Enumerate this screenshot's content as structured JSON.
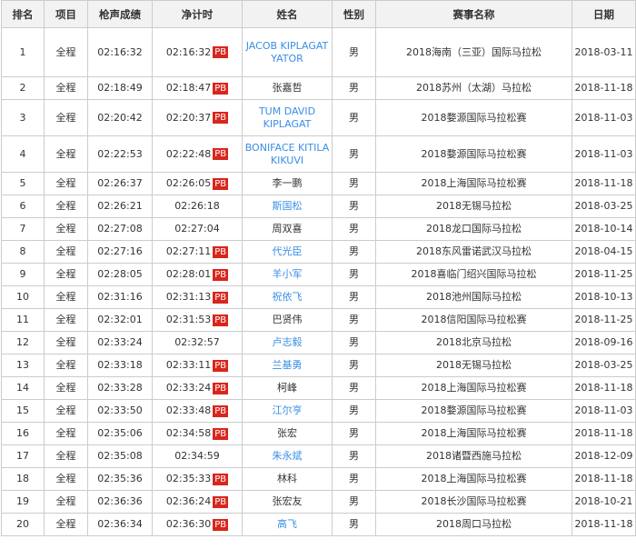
{
  "headers": [
    "排名",
    "项目",
    "枪声成绩",
    "净计时",
    "姓名",
    "性别",
    "赛事名称",
    "日期"
  ],
  "pb_label": "PB",
  "link_color": "#3a8ee6",
  "pb_color": "#d9261c",
  "rows": [
    {
      "rank": "1",
      "item": "全程",
      "gun": "02:16:32",
      "net": "02:16:32",
      "pb": true,
      "name": "JACOB KIPLAGAT YATOR",
      "link": true,
      "gender": "男",
      "race": "2018海南（三亚）国际马拉松",
      "date": "2018-03-11"
    },
    {
      "rank": "2",
      "item": "全程",
      "gun": "02:18:49",
      "net": "02:18:47",
      "pb": true,
      "name": "张嘉哲",
      "link": false,
      "gender": "男",
      "race": "2018苏州（太湖）马拉松",
      "date": "2018-11-18"
    },
    {
      "rank": "3",
      "item": "全程",
      "gun": "02:20:42",
      "net": "02:20:37",
      "pb": true,
      "name": "TUM DAVID KIPLAGAT",
      "link": true,
      "gender": "男",
      "race": "2018婺源国际马拉松赛",
      "date": "2018-11-03"
    },
    {
      "rank": "4",
      "item": "全程",
      "gun": "02:22:53",
      "net": "02:22:48",
      "pb": true,
      "name": "BONIFACE KITILA KIKUVI",
      "link": true,
      "gender": "男",
      "race": "2018婺源国际马拉松赛",
      "date": "2018-11-03"
    },
    {
      "rank": "5",
      "item": "全程",
      "gun": "02:26:37",
      "net": "02:26:05",
      "pb": true,
      "name": "李一鹏",
      "link": false,
      "gender": "男",
      "race": "2018上海国际马拉松赛",
      "date": "2018-11-18"
    },
    {
      "rank": "6",
      "item": "全程",
      "gun": "02:26:21",
      "net": "02:26:18",
      "pb": false,
      "name": "斯国松",
      "link": true,
      "gender": "男",
      "race": "2018无锡马拉松",
      "date": "2018-03-25"
    },
    {
      "rank": "7",
      "item": "全程",
      "gun": "02:27:08",
      "net": "02:27:04",
      "pb": false,
      "name": "周双喜",
      "link": false,
      "gender": "男",
      "race": "2018龙口国际马拉松",
      "date": "2018-10-14"
    },
    {
      "rank": "8",
      "item": "全程",
      "gun": "02:27:16",
      "net": "02:27:11",
      "pb": true,
      "name": "代光臣",
      "link": true,
      "gender": "男",
      "race": "2018东风雷诺武汉马拉松",
      "date": "2018-04-15"
    },
    {
      "rank": "9",
      "item": "全程",
      "gun": "02:28:05",
      "net": "02:28:01",
      "pb": true,
      "name": "羊小军",
      "link": true,
      "gender": "男",
      "race": "2018喜临门绍兴国际马拉松",
      "date": "2018-11-25"
    },
    {
      "rank": "10",
      "item": "全程",
      "gun": "02:31:16",
      "net": "02:31:13",
      "pb": true,
      "name": "祝依飞",
      "link": true,
      "gender": "男",
      "race": "2018池州国际马拉松",
      "date": "2018-10-13"
    },
    {
      "rank": "11",
      "item": "全程",
      "gun": "02:32:01",
      "net": "02:31:53",
      "pb": true,
      "name": "巴贤伟",
      "link": false,
      "gender": "男",
      "race": "2018信阳国际马拉松赛",
      "date": "2018-11-25"
    },
    {
      "rank": "12",
      "item": "全程",
      "gun": "02:33:24",
      "net": "02:32:57",
      "pb": false,
      "name": "卢志毅",
      "link": true,
      "gender": "男",
      "race": "2018北京马拉松",
      "date": "2018-09-16"
    },
    {
      "rank": "13",
      "item": "全程",
      "gun": "02:33:18",
      "net": "02:33:11",
      "pb": true,
      "name": "兰基勇",
      "link": true,
      "gender": "男",
      "race": "2018无锡马拉松",
      "date": "2018-03-25"
    },
    {
      "rank": "14",
      "item": "全程",
      "gun": "02:33:28",
      "net": "02:33:24",
      "pb": true,
      "name": "柯峰",
      "link": false,
      "gender": "男",
      "race": "2018上海国际马拉松赛",
      "date": "2018-11-18"
    },
    {
      "rank": "15",
      "item": "全程",
      "gun": "02:33:50",
      "net": "02:33:48",
      "pb": true,
      "name": "江尔亨",
      "link": true,
      "gender": "男",
      "race": "2018婺源国际马拉松赛",
      "date": "2018-11-03"
    },
    {
      "rank": "16",
      "item": "全程",
      "gun": "02:35:06",
      "net": "02:34:58",
      "pb": true,
      "name": "张宏",
      "link": false,
      "gender": "男",
      "race": "2018上海国际马拉松赛",
      "date": "2018-11-18"
    },
    {
      "rank": "17",
      "item": "全程",
      "gun": "02:35:08",
      "net": "02:34:59",
      "pb": false,
      "name": "朱永斌",
      "link": true,
      "gender": "男",
      "race": "2018诸暨西施马拉松",
      "date": "2018-12-09"
    },
    {
      "rank": "18",
      "item": "全程",
      "gun": "02:35:36",
      "net": "02:35:33",
      "pb": true,
      "name": "林科",
      "link": false,
      "gender": "男",
      "race": "2018上海国际马拉松赛",
      "date": "2018-11-18"
    },
    {
      "rank": "19",
      "item": "全程",
      "gun": "02:36:36",
      "net": "02:36:24",
      "pb": true,
      "name": "张宏友",
      "link": false,
      "gender": "男",
      "race": "2018长沙国际马拉松赛",
      "date": "2018-10-21"
    },
    {
      "rank": "20",
      "item": "全程",
      "gun": "02:36:34",
      "net": "02:36:30",
      "pb": true,
      "name": "高飞",
      "link": true,
      "gender": "男",
      "race": "2018周口马拉松",
      "date": "2018-11-18"
    }
  ]
}
